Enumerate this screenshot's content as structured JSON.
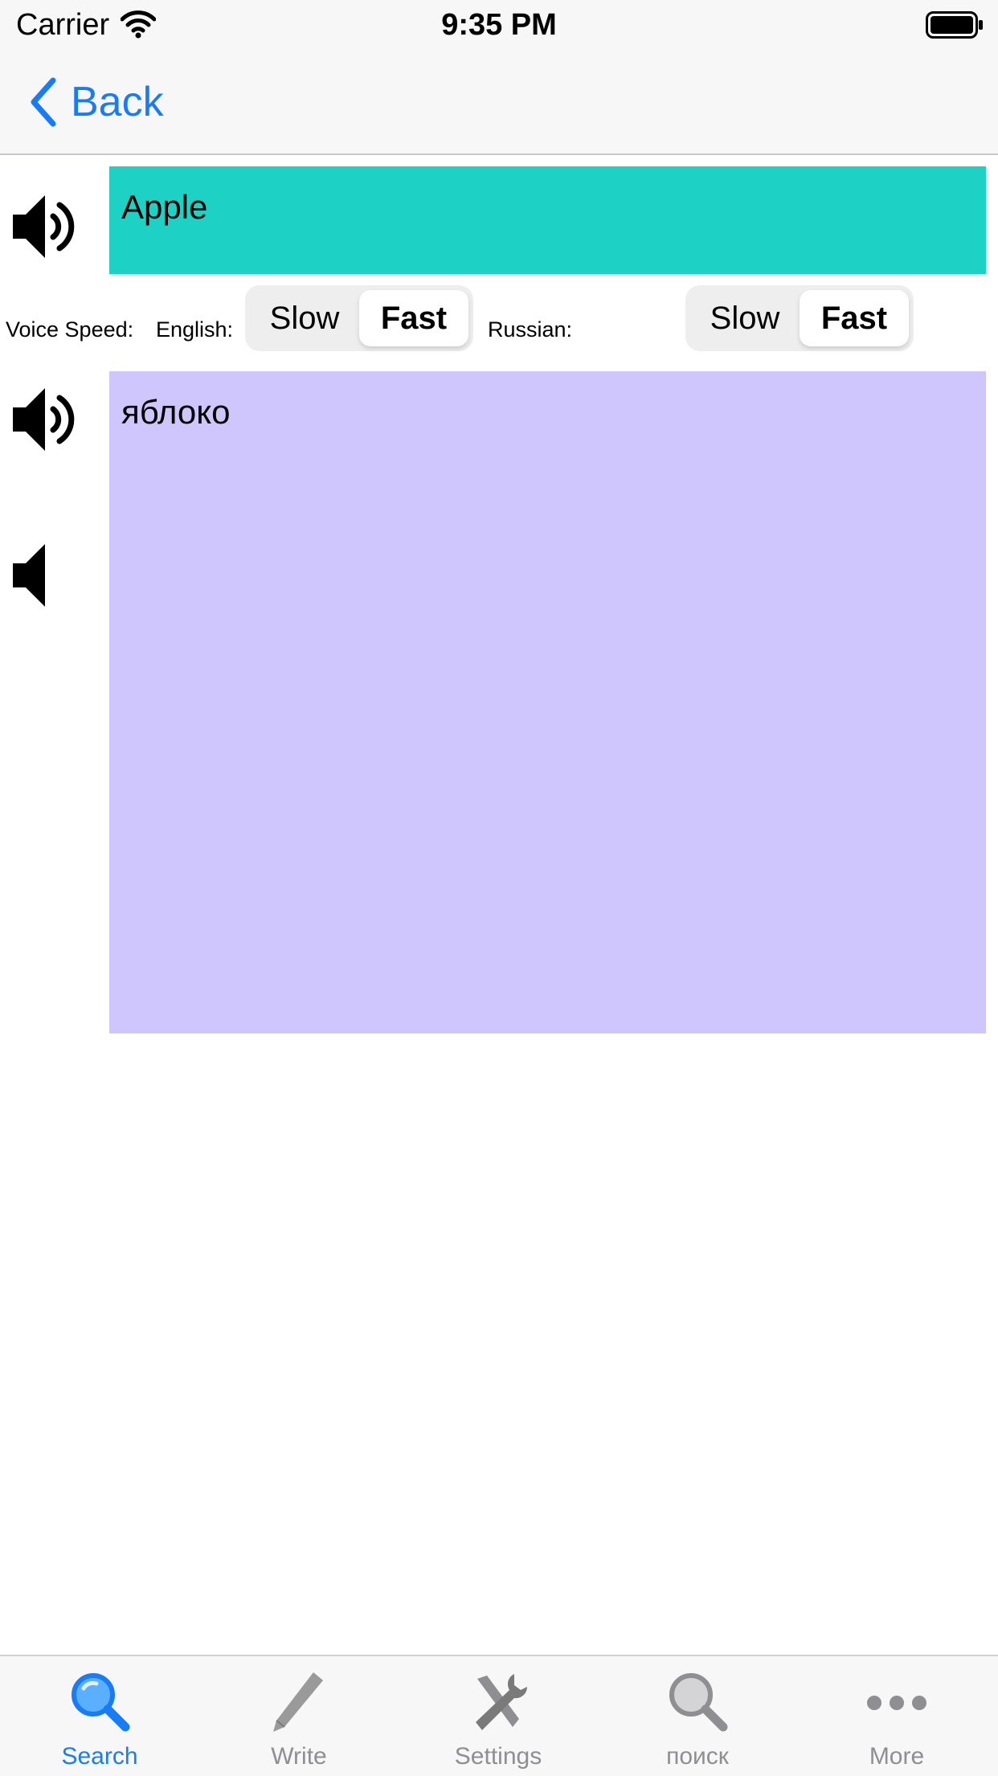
{
  "status_bar": {
    "carrier": "Carrier",
    "time": "9:35 PM"
  },
  "nav": {
    "back_label": "Back"
  },
  "english": {
    "text": "Apple",
    "box_color": "#1dd2c4"
  },
  "voice_speed": {
    "label": "Voice Speed:",
    "english_label": "English:",
    "russian_label": "Russian:",
    "english_segments": [
      "Slow",
      "Fast"
    ],
    "english_selected": "Fast",
    "russian_segments": [
      "Slow",
      "Fast"
    ],
    "russian_selected": "Fast"
  },
  "russian": {
    "text": "яблоко",
    "box_color": "#d0c6fe"
  },
  "tabs": [
    {
      "label": "Search",
      "icon": "magnifier-icon",
      "active": true
    },
    {
      "label": "Write",
      "icon": "pencil-icon",
      "active": false
    },
    {
      "label": "Settings",
      "icon": "tools-icon",
      "active": false
    },
    {
      "label": "поиск",
      "icon": "magnifier-icon",
      "active": false
    },
    {
      "label": "More",
      "icon": "more-dots-icon",
      "active": false
    }
  ],
  "colors": {
    "accent": "#1a7cf5",
    "tab_inactive": "#8e8e93"
  }
}
